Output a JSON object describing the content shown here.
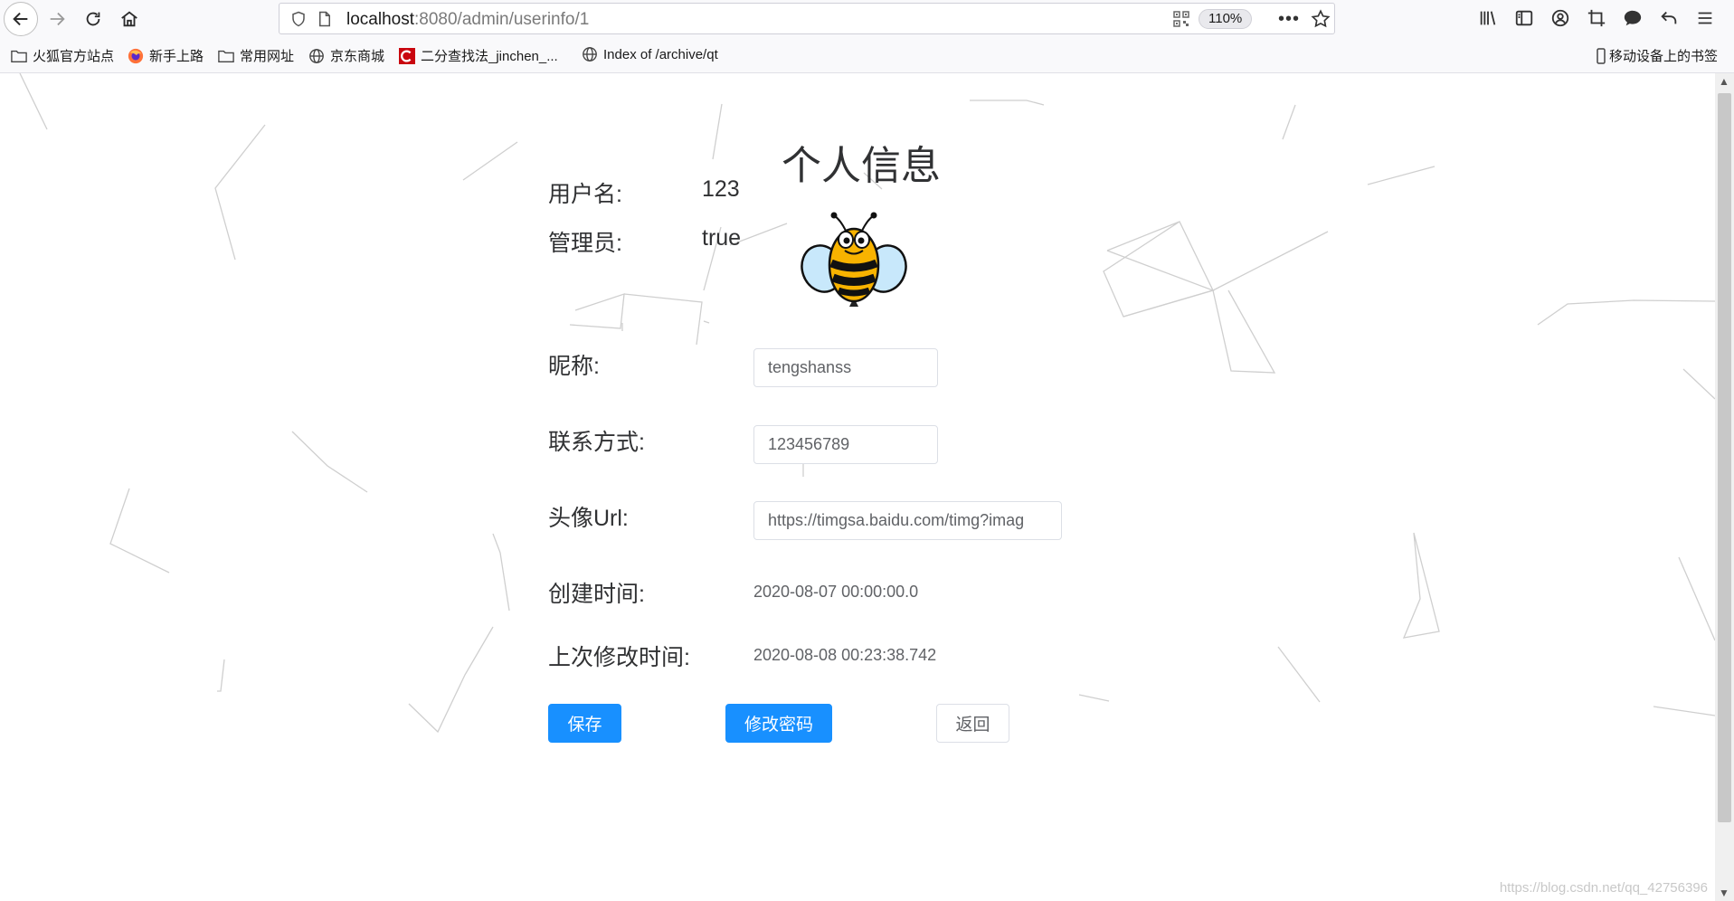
{
  "browser": {
    "url_host": "localhost",
    "url_path": ":8080/admin/userinfo/1",
    "zoom": "110%",
    "bookmarks": [
      {
        "label": "火狐官方站点",
        "icon": "folder-icon"
      },
      {
        "label": "新手上路",
        "icon": "firefox-icon"
      },
      {
        "label": "常用网址",
        "icon": "folder-icon"
      },
      {
        "label": "京东商城",
        "icon": "globe-icon"
      },
      {
        "label": "二分查找法_jinchen_...",
        "icon": "csdn-icon"
      },
      {
        "label": "Index of /archive/qt",
        "icon": "globe-icon"
      }
    ],
    "mobile_bookmarks": "移动设备上的书签"
  },
  "page": {
    "title": "个人信息",
    "username_label": "用户名:",
    "username_value": "123",
    "admin_label": "管理员:",
    "admin_value": "true",
    "nickname_label": "昵称:",
    "nickname_value": "tengshanss",
    "contact_label": "联系方式:",
    "contact_value": "123456789",
    "avatar_url_label": "头像Url:",
    "avatar_url_value": "https://timgsa.baidu.com/timg?imag",
    "created_label": "创建时间:",
    "created_value": "2020-08-07 00:00:00.0",
    "modified_label": "上次修改时间:",
    "modified_value": "2020-08-08 00:23:38.742",
    "save_button": "保存",
    "change_password_button": "修改密码",
    "back_button": "返回",
    "avatar_icon": "bee-icon"
  },
  "watermark": "https://blog.csdn.net/qq_42756396",
  "colors": {
    "primary": "#1890ff",
    "text": "#303133",
    "muted": "#606266",
    "border": "#dcdfe6"
  }
}
